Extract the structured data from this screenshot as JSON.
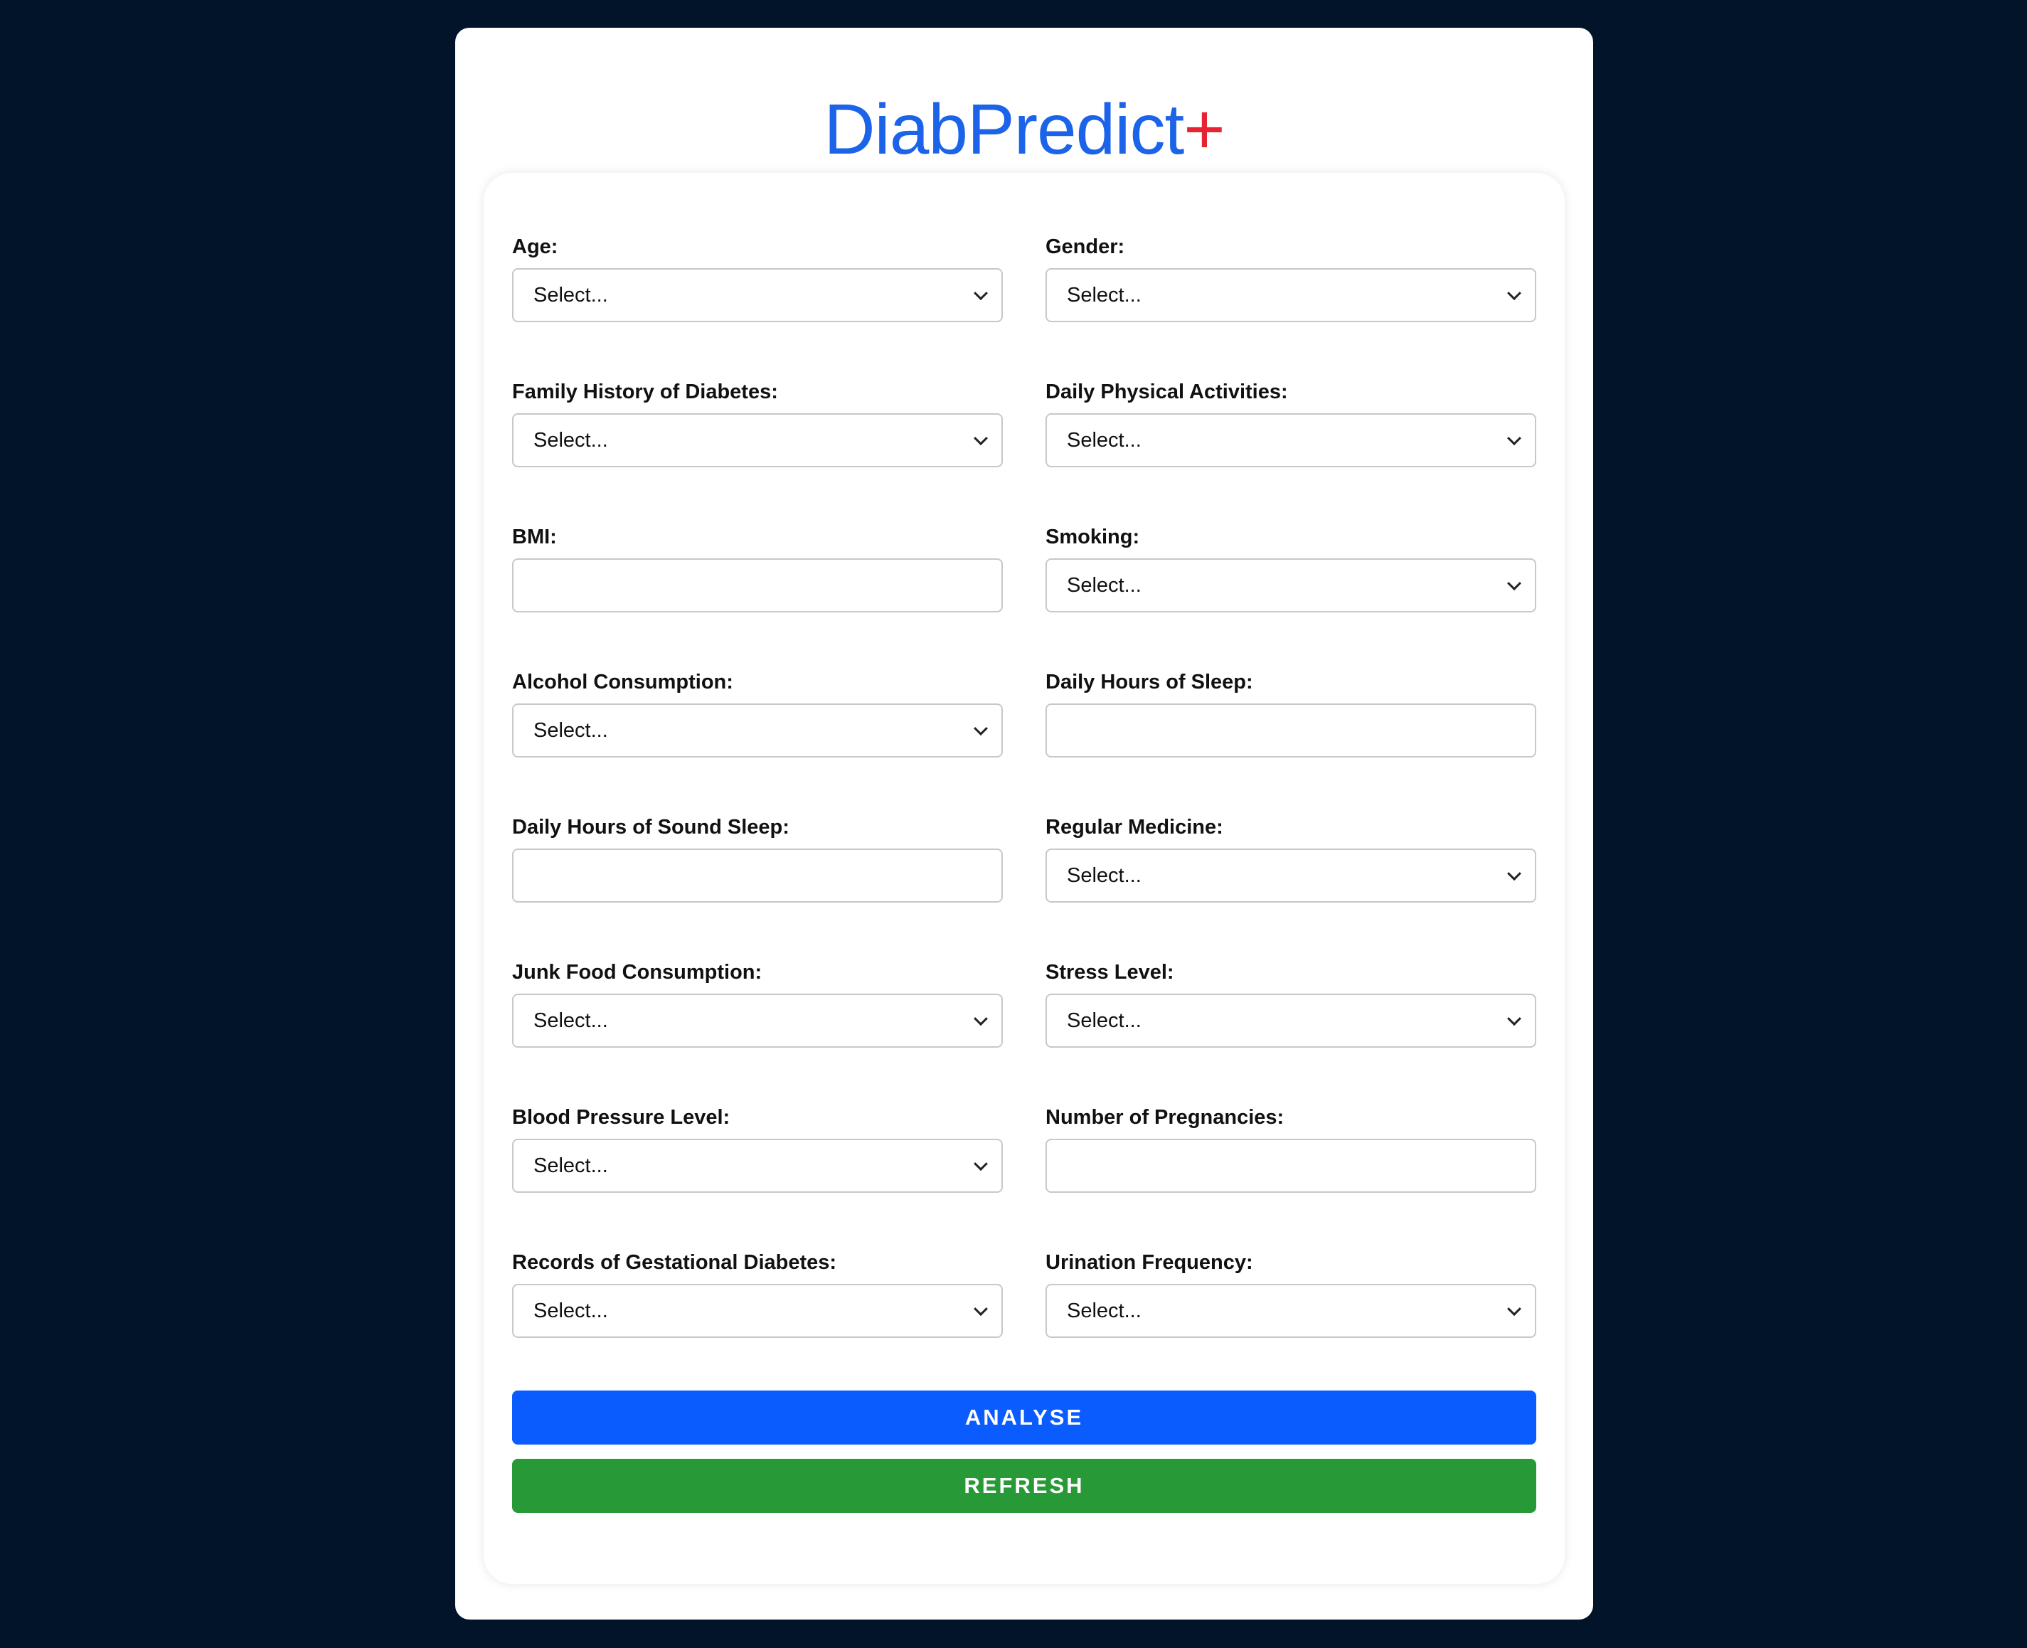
{
  "app": {
    "title_main": "DiabPredict",
    "title_mark": "+"
  },
  "colors": {
    "page_bg": "#02142a",
    "title_blue": "#1b63e8",
    "title_plus_red": "#e62233",
    "analyse_button": "#0b5cff",
    "refresh_button": "#279a37"
  },
  "form": {
    "fields": [
      {
        "label": "Age:",
        "type": "select",
        "value": "Select..."
      },
      {
        "label": "Gender:",
        "type": "select",
        "value": "Select..."
      },
      {
        "label": "Family History of Diabetes:",
        "type": "select",
        "value": "Select..."
      },
      {
        "label": "Daily Physical Activities:",
        "type": "select",
        "value": "Select..."
      },
      {
        "label": "BMI:",
        "type": "input",
        "value": ""
      },
      {
        "label": "Smoking:",
        "type": "select",
        "value": "Select..."
      },
      {
        "label": "Alcohol Consumption:",
        "type": "select",
        "value": "Select..."
      },
      {
        "label": "Daily Hours of Sleep:",
        "type": "input",
        "value": ""
      },
      {
        "label": "Daily Hours of Sound Sleep:",
        "type": "input",
        "value": ""
      },
      {
        "label": "Regular Medicine:",
        "type": "select",
        "value": "Select..."
      },
      {
        "label": "Junk Food Consumption:",
        "type": "select",
        "value": "Select..."
      },
      {
        "label": "Stress Level:",
        "type": "select",
        "value": "Select..."
      },
      {
        "label": "Blood Pressure Level:",
        "type": "select",
        "value": "Select..."
      },
      {
        "label": "Number of Pregnancies:",
        "type": "input",
        "value": ""
      },
      {
        "label": "Records of Gestational Diabetes:",
        "type": "select",
        "value": "Select..."
      },
      {
        "label": "Urination Frequency:",
        "type": "select",
        "value": "Select..."
      }
    ]
  },
  "buttons": {
    "analyse_label": "ANALYSE",
    "refresh_label": "REFRESH"
  }
}
